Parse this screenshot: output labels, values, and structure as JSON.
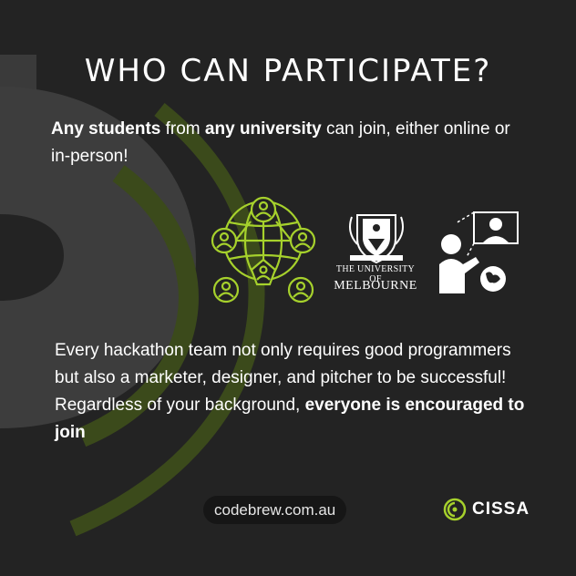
{
  "title": "WHO CAN PARTICIPATE?",
  "intro": {
    "bold1": "Any students",
    "text1": " from ",
    "bold2": "any university",
    "text2": " can join, either online or in-person!"
  },
  "icons": {
    "network": "globe-network-icon",
    "university": "university-crest-icon",
    "online": "online-presenter-icon"
  },
  "university": {
    "line1": "THE UNIVERSITY OF",
    "line2": "MELBOURNE"
  },
  "description": {
    "text": "Every hackathon team not only requires good programmers but also a marketer, designer, and pitcher to be successful! Regardless of your background, ",
    "bold": "everyone is encouraged to join"
  },
  "footer": {
    "url": "codebrew.com.au",
    "logo": "CISSA"
  },
  "colors": {
    "background": "#232323",
    "accent": "#a6d12c",
    "text": "#ffffff"
  }
}
